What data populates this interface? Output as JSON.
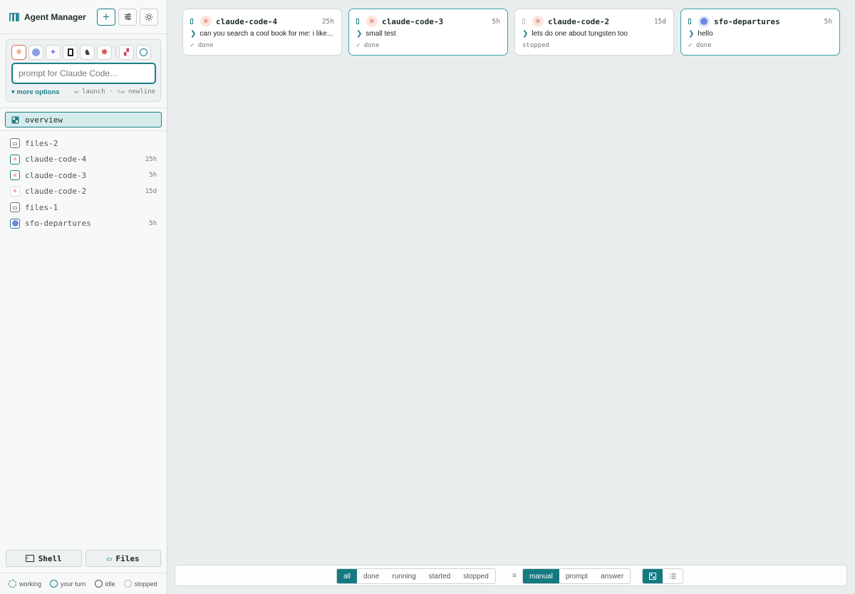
{
  "app": {
    "title": "Agent Manager"
  },
  "toolbar": {
    "new_icon": "plus-icon",
    "settings_icon": "sliders-icon",
    "theme_icon": "sun-icon"
  },
  "launcher": {
    "placeholder": "prompt for Claude Code…",
    "more_options": "▾ more options",
    "hint": "↵ launch · ⇧↵ newline",
    "agents": [
      "claude-code",
      "globe-agent",
      "sparkle-agent",
      "terminal-agent",
      "penguin-agent",
      "red-gear-agent",
      "apps-agent",
      "openai-agent"
    ]
  },
  "overview": {
    "label": "overview"
  },
  "nav": [
    {
      "label": "files-2",
      "age": "",
      "icon": "folder-icon"
    },
    {
      "label": "claude-code-4",
      "age": "25h",
      "icon": "claude-icon"
    },
    {
      "label": "claude-code-3",
      "age": "5h",
      "icon": "claude-icon"
    },
    {
      "label": "claude-code-2",
      "age": "15d",
      "icon": "claude-icon"
    },
    {
      "label": "files-1",
      "age": "",
      "icon": "folder-icon"
    },
    {
      "label": "sfo-departures",
      "age": "5h",
      "icon": "globe-icon"
    }
  ],
  "buttons": {
    "shell": "Shell",
    "files": "Files"
  },
  "legend": [
    "working",
    "your turn",
    "idle",
    "stopped"
  ],
  "cards": [
    {
      "title": "claude-code-4",
      "age": "25h",
      "message": "can you search a cool book for me: i like...",
      "status": "✓ done"
    },
    {
      "title": "claude-code-3",
      "age": "5h",
      "message": "small test",
      "status": "✓ done"
    },
    {
      "title": "claude-code-2",
      "age": "15d",
      "message": "lets do one about tungsten too",
      "status": "stopped"
    },
    {
      "title": "sfo-departures",
      "age": "5h",
      "message": "hello",
      "status": "✓ done"
    }
  ],
  "filters": {
    "status": [
      "all",
      "done",
      "running",
      "started",
      "stopped"
    ],
    "sort": [
      "manual",
      "prompt",
      "answer"
    ],
    "view_icons": [
      "grid-view-icon",
      "list-view-icon"
    ]
  },
  "colors": {
    "accent": "#147a82",
    "claude": "#d96c4f",
    "background": "#e9edee"
  }
}
